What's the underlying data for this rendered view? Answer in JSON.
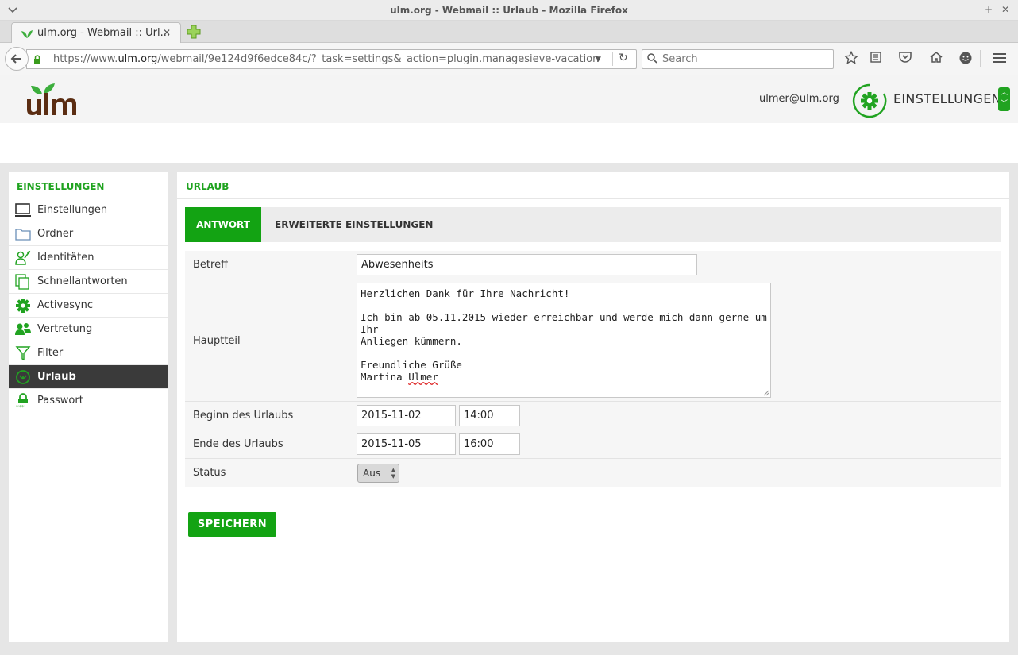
{
  "window": {
    "title": "ulm.org - Webmail :: Urlaub - Mozilla Firefox",
    "min": "‒",
    "max": "+",
    "close": "✕"
  },
  "browser": {
    "tab_title": "ulm.org - Webmail :: Url...",
    "tab_close": "✕",
    "url_prefix": "https://www.",
    "url_domain": "ulm.org",
    "url_rest": "/webmail/9e124d9f6edce84c/?_task=settings&_action=plugin.managesieve-vacation",
    "search_placeholder": "Search"
  },
  "app": {
    "user_email": "ulmer@ulm.org",
    "top_section": "EINSTELLUNGEN",
    "accent": "#13a313"
  },
  "sidebar": {
    "heading": "EINSTELLUNGEN",
    "items": [
      {
        "label": "Einstellungen",
        "icon": "monitor-icon"
      },
      {
        "label": "Ordner",
        "icon": "folder-icon"
      },
      {
        "label": "Identitäten",
        "icon": "identity-icon"
      },
      {
        "label": "Schnellantworten",
        "icon": "responses-icon"
      },
      {
        "label": "Activesync",
        "icon": "gear-icon"
      },
      {
        "label": "Vertretung",
        "icon": "users-icon"
      },
      {
        "label": "Filter",
        "icon": "filter-icon"
      },
      {
        "label": "Urlaub",
        "icon": "vacation-icon",
        "active": true
      },
      {
        "label": "Passwort",
        "icon": "lock-icon"
      }
    ]
  },
  "main": {
    "heading": "URLAUB",
    "tabs": {
      "active": "ANTWORT",
      "other": "ERWEITERTE EINSTELLUNGEN"
    },
    "form": {
      "subject_label": "Betreff",
      "subject_value": "Abwesenheits",
      "body_label": "Hauptteil",
      "body_line1": "Herzlichen Dank für Ihre Nachricht!",
      "body_line2": "Ich bin ab 05.11.2015 wieder erreichbar und werde mich dann gerne um Ihr",
      "body_line3": "Anliegen kümmern.",
      "body_line4": "Freundliche Grüße",
      "body_line5a": "Martina ",
      "body_line5b": "Ulmer",
      "start_label": "Beginn des Urlaubs",
      "start_date": "2015-11-02",
      "start_time": "14:00",
      "end_label": "Ende des Urlaubs",
      "end_date": "2015-11-05",
      "end_time": "16:00",
      "status_label": "Status",
      "status_value": "Aus"
    },
    "save_label": "SPEICHERN"
  }
}
